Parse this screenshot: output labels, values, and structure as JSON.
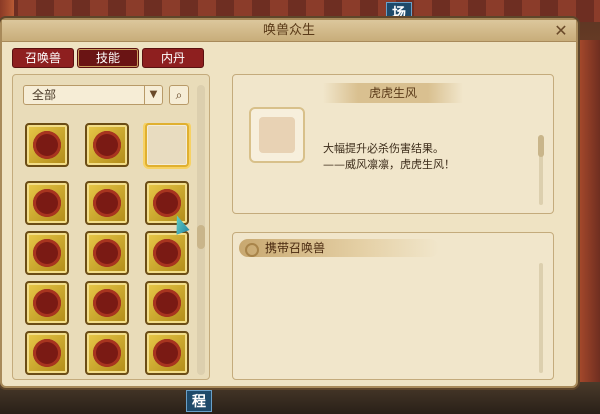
{
  "background": {
    "sign_top": "场",
    "sign_bottom": "程"
  },
  "window": {
    "title": "唤兽众生",
    "close_icon": "close-icon"
  },
  "tabs": [
    {
      "label": "召唤兽"
    },
    {
      "label": "技能",
      "active": true
    },
    {
      "label": "内丹"
    }
  ],
  "filter": {
    "selected": "全部",
    "search_icon": "search-icon"
  },
  "skill_grid": {
    "rows": [
      [
        "phoenix",
        "beast",
        "empty-selected"
      ],
      [
        "dragon",
        "tiger",
        "flame"
      ],
      [
        "crane",
        "bird",
        "crescent"
      ],
      [
        "shield",
        "fox",
        "curse"
      ],
      [
        "scroll",
        "cat",
        "serpent"
      ]
    ]
  },
  "skill_detail": {
    "name": "虎虎生风",
    "desc_line1": "大幅提升必杀伤害结果。",
    "desc_line2": "——威风凛凛，虎虎生风！"
  },
  "carry_panel": {
    "header": "携带召唤兽"
  },
  "colors": {
    "tab_red": "#8e1f1f",
    "panel_bg": "#f1e6cb",
    "icon_gold": "#e8c848"
  }
}
